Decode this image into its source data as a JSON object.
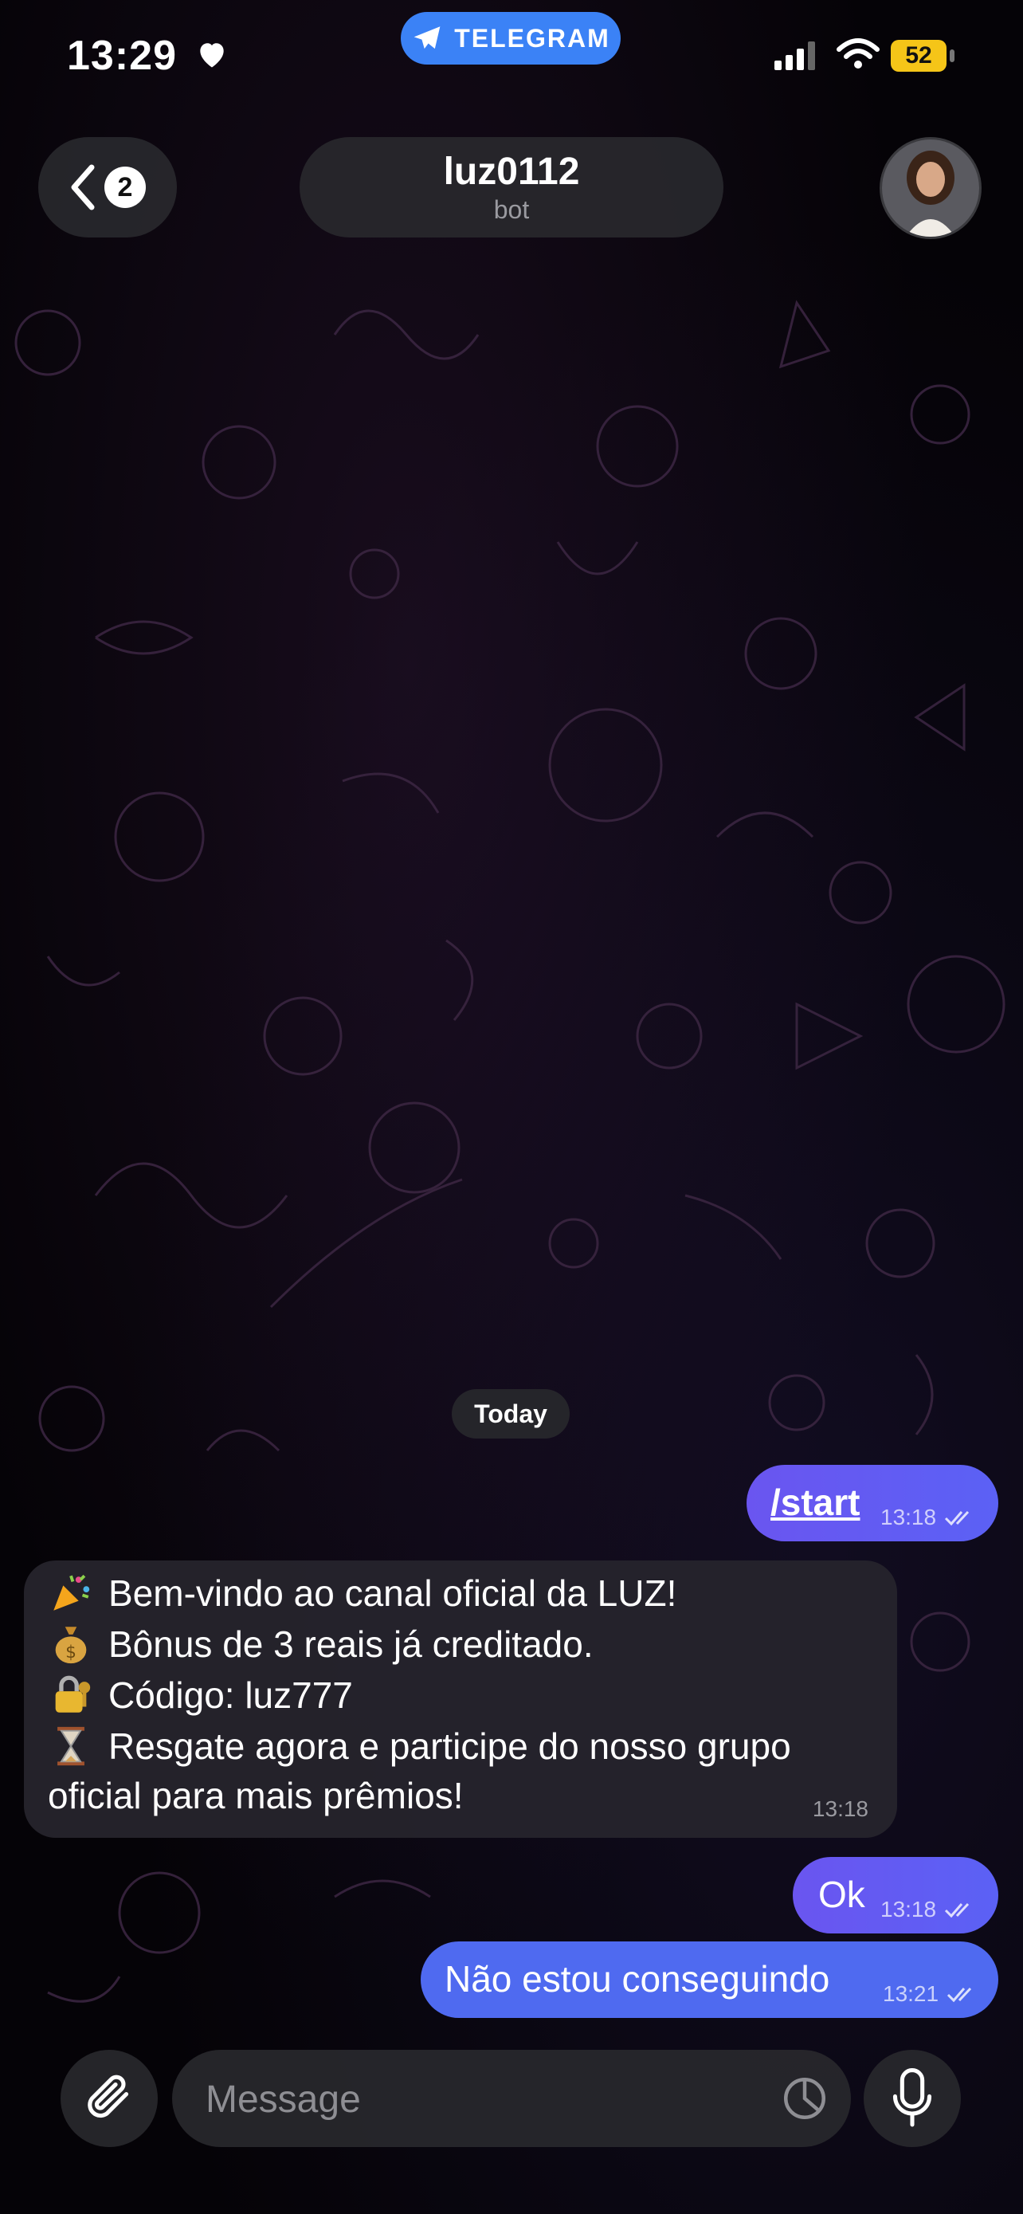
{
  "status_bar": {
    "time": "13:29",
    "battery": "52"
  },
  "telegram_pill": {
    "label": "TELEGRAM"
  },
  "header": {
    "back_count": "2",
    "title": "luz0112",
    "subtitle": "bot"
  },
  "chat": {
    "date_label": "Today",
    "messages": [
      {
        "direction": "out",
        "text": "/start",
        "time": "13:18"
      },
      {
        "direction": "in",
        "lines": [
          {
            "emoji": "party-popper-icon",
            "text": "Bem-vindo ao canal oficial da LUZ!"
          },
          {
            "emoji": "money-bag-icon",
            "text": "Bônus de 3 reais já creditado."
          },
          {
            "emoji": "lock-key-icon",
            "text": "Código: luz777"
          },
          {
            "emoji": "hourglass-icon",
            "text": "Resgate agora e participe do nosso grupo"
          },
          {
            "emoji": "",
            "text": "oficial para mais prêmios!"
          }
        ],
        "time": "13:18"
      },
      {
        "direction": "out",
        "text": "Ok",
        "time": "13:18"
      },
      {
        "direction": "out",
        "text": "Não estou conseguindo",
        "time": "13:21"
      }
    ]
  },
  "composer": {
    "placeholder": "Message"
  },
  "colors": {
    "outgoing_bubble": "#6a55f0",
    "incoming_bubble": "#26242c",
    "telegram_blue": "#3b82f6",
    "battery": "#f5c518"
  }
}
